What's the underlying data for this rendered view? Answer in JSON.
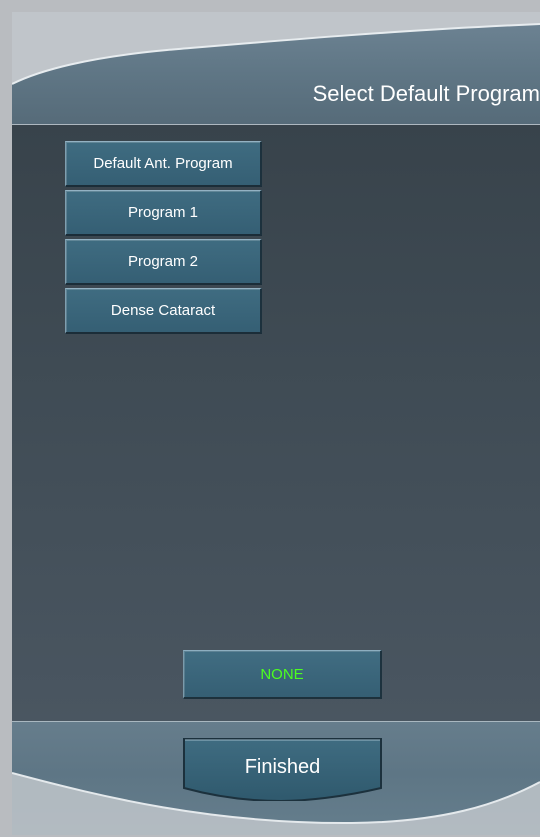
{
  "header": {
    "title": "Select Default Program"
  },
  "programs": {
    "items": [
      {
        "label": "Default Ant. Program"
      },
      {
        "label": "Program 1"
      },
      {
        "label": "Program 2"
      },
      {
        "label": "Dense Cataract"
      }
    ]
  },
  "actions": {
    "none_label": "NONE",
    "finished_label": "Finished"
  },
  "colors": {
    "header": "#5f7685",
    "content": "#3e4a53",
    "button": "#355f74",
    "none_text": "#4cff1f",
    "text": "#ffffff"
  }
}
